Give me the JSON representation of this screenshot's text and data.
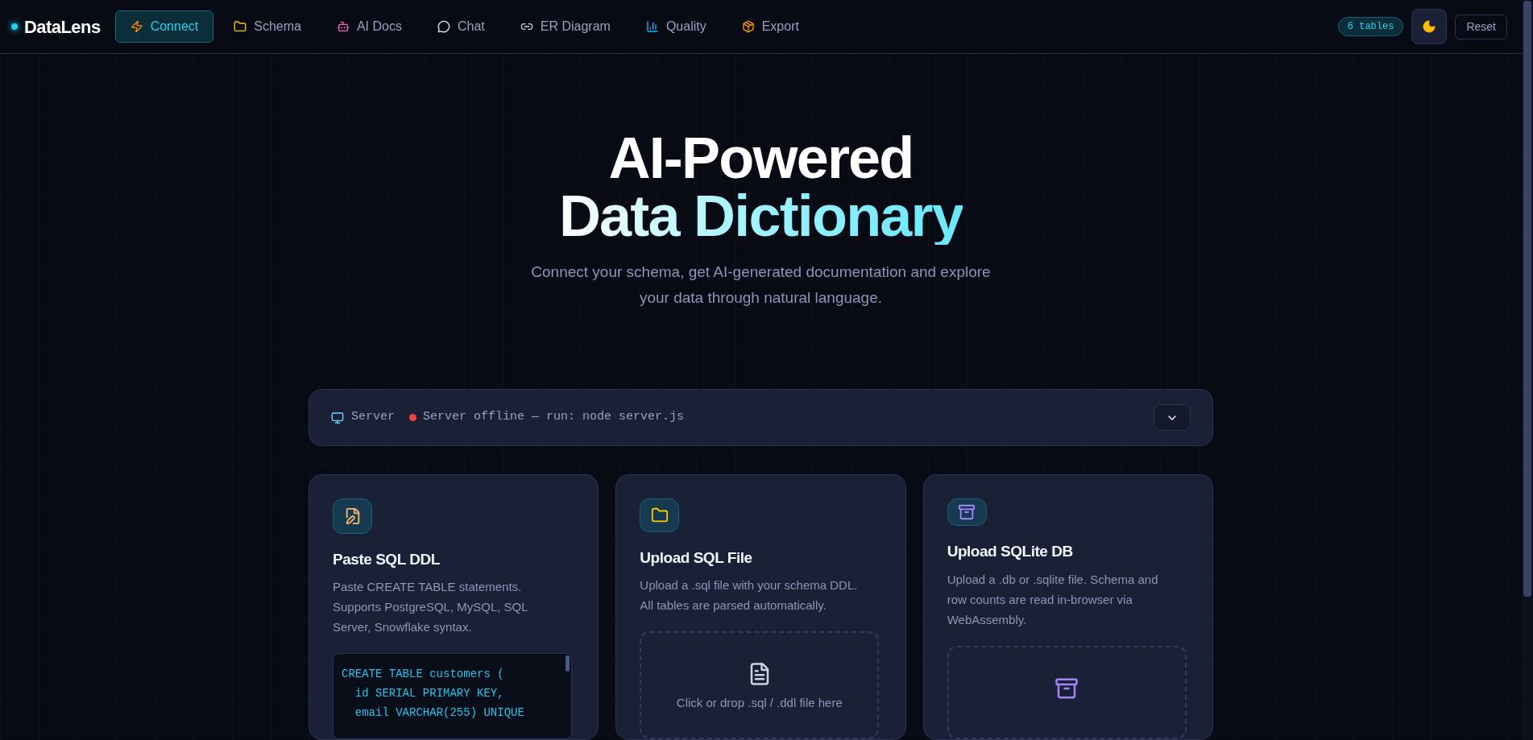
{
  "brand": {
    "name": "DataLens"
  },
  "nav": [
    {
      "label": "Connect",
      "selected": true
    },
    {
      "label": "Schema",
      "selected": false
    },
    {
      "label": "AI Docs",
      "selected": false
    },
    {
      "label": "Chat",
      "selected": false
    },
    {
      "label": "ER Diagram",
      "selected": false
    },
    {
      "label": "Quality",
      "selected": false
    },
    {
      "label": "Export",
      "selected": false
    }
  ],
  "header_actions": {
    "tables_badge": "6 tables",
    "reset": "Reset"
  },
  "hero": {
    "title_line_1": "AI-Powered",
    "title_line_2": "Data Dictionary",
    "subtitle_line_1": "Connect your schema, get AI-generated documentation and explore",
    "subtitle_line_2": "your data through natural language."
  },
  "server": {
    "label": "Server",
    "status": "Server offline — run: node server.js",
    "online": false
  },
  "cards": [
    {
      "kind": "editor",
      "title": "Paste SQL DDL",
      "description": "Paste CREATE TABLE statements. Supports PostgreSQL, MySQL, SQL Server, Snowflake syntax.",
      "code": "CREATE TABLE customers (\n  id SERIAL PRIMARY KEY,\n  email VARCHAR(255) UNIQUE"
    },
    {
      "kind": "dropzone",
      "title": "Upload SQL File",
      "description": "Upload a .sql file with your schema DDL. All tables are parsed automatically.",
      "drop_text": "Click or drop .sql / .ddl file here"
    },
    {
      "kind": "dropzone",
      "title": "Upload SQLite DB",
      "description": "Upload a .db or .sqlite file. Schema and row counts are read in-browser via WebAssembly."
    }
  ]
}
